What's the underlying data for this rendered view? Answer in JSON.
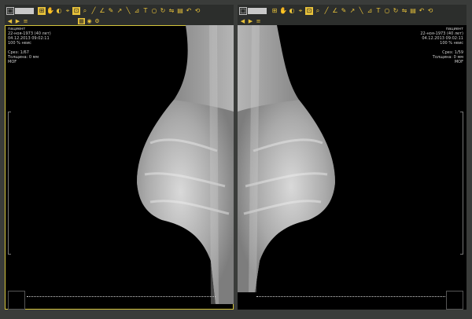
{
  "toolbar": {
    "icons": [
      "layout-icon",
      "zoom-icon",
      "hand-icon",
      "window-level-icon",
      "select-icon",
      "fit-icon",
      "magnifier-icon",
      "ruler-icon",
      "angle-icon",
      "pen-icon",
      "arrow-icon",
      "line-icon",
      "measure-icon",
      "text-icon",
      "roi-icon",
      "rotate-icon",
      "flip-icon",
      "histogram-icon",
      "undo-icon",
      "reset-icon"
    ],
    "row2_icons": [
      "prev-arrow-icon",
      "next-arrow-icon",
      "stack-icon",
      "grid-icon",
      "cine-icon",
      "settings-icon"
    ]
  },
  "left_panel": {
    "info": [
      "пациент",
      "22-ноя-1973 (40 лет)",
      "04.12.2013 09:02:11",
      "100 % неис",
      "",
      "Срез: 1/67",
      "Толщина: 0 мм",
      "MOF"
    ]
  },
  "right_panel": {
    "info": [
      "пациент",
      "22-ноя-1973 (40 лет)",
      "04.12.2013 09:02:11",
      "100 % неис",
      "",
      "Срез: 1/59",
      "Толщина: 0 мм",
      "MOF"
    ]
  },
  "colors": {
    "accent": "#e8c23a",
    "frame": "#3a3c3a",
    "viewport": "#000000",
    "active_border": "#d4c43c"
  }
}
